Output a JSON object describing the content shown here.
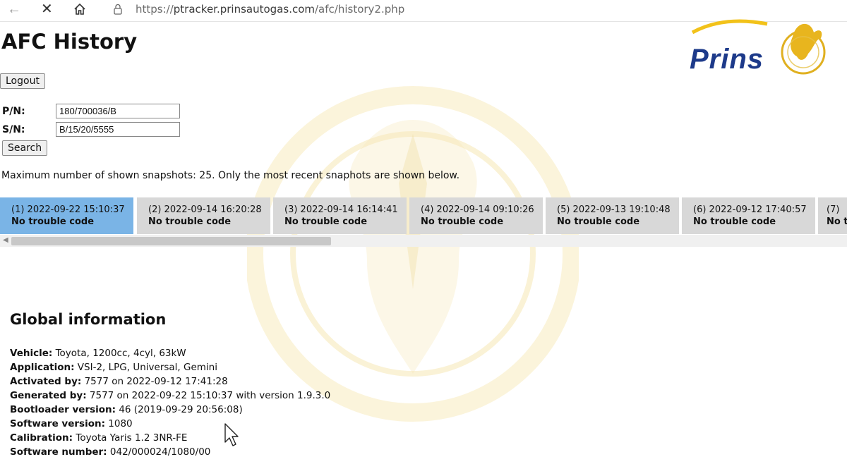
{
  "browser": {
    "url_prefix": "https://",
    "url_host": "ptracker.prinsautogas.com",
    "url_path": "/afc/history2.php",
    "icons": [
      "back-arrow-icon",
      "close-icon",
      "home-icon",
      "lock-icon"
    ]
  },
  "logo": {
    "text": "Prins"
  },
  "page": {
    "title": "AFC History",
    "logout_label": "Logout",
    "pn_label": "P/N:",
    "pn_value": "180/700036/B",
    "sn_label": "S/N:",
    "sn_value": "B/15/20/5555",
    "search_label": "Search",
    "notice": "Maximum number of shown snapshots: 25. Only the most recent snaphots are shown below."
  },
  "snapshots": [
    {
      "line1": "(1) 2022-09-22 15:10:37",
      "line2": "No trouble code",
      "active": true
    },
    {
      "line1": "(2) 2022-09-14 16:20:28",
      "line2": "No trouble code",
      "active": false
    },
    {
      "line1": "(3) 2022-09-14 16:14:41",
      "line2": "No trouble code",
      "active": false
    },
    {
      "line1": "(4) 2022-09-14 09:10:26",
      "line2": "No trouble code",
      "active": false
    },
    {
      "line1": "(5) 2022-09-13 19:10:48",
      "line2": "No trouble code",
      "active": false
    },
    {
      "line1": "(6) 2022-09-12 17:40:57",
      "line2": "No trouble code",
      "active": false
    },
    {
      "line1": "(7)",
      "line2": "No t",
      "active": false
    }
  ],
  "global": {
    "title": "Global information",
    "rows": [
      {
        "key": "Vehicle:",
        "value": " Toyota, 1200cc, 4cyl, 63kW"
      },
      {
        "key": "Application:",
        "value": " VSI-2, LPG, Universal, Gemini"
      },
      {
        "key": "Activated by:",
        "value": " 7577 on 2022-09-12 17:41:28"
      },
      {
        "key": "Generated by:",
        "value": " 7577 on 2022-09-22 15:10:37 with version 1.9.3.0"
      },
      {
        "key": "Bootloader version:",
        "value": " 46 (2019-09-29 20:56:08)"
      },
      {
        "key": "Software version:",
        "value": " 1080"
      },
      {
        "key": "Calibration:",
        "value": " Toyota Yaris 1.2 3NR-FE"
      },
      {
        "key": "Software number:",
        "value": " 042/000024/1080/00"
      }
    ]
  },
  "colors": {
    "active_tab": "#7ab4e6",
    "tab": "#d8d8d8",
    "logo_blue": "#1d3a8a",
    "seal_gold": "#e8c340"
  }
}
